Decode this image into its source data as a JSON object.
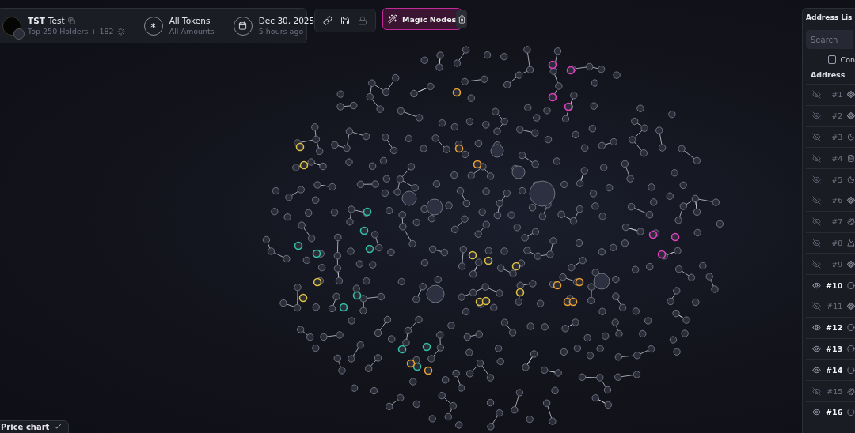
{
  "header": {
    "token": {
      "symbol": "TST",
      "name": "Test",
      "subtitle": "Top 250 Holders + 182"
    },
    "filter": {
      "title": "All Tokens",
      "subtitle": "All Amounts"
    },
    "date": {
      "title": "Dec 30, 2025",
      "subtitle": "5 hours ago"
    }
  },
  "toolbar": {
    "magic_button": "Magic Nodes"
  },
  "address_panel": {
    "title": "Address Lis",
    "search_placeholder": "Search",
    "checkbox": {
      "label": "Con",
      "checked": false
    },
    "column": "Address",
    "rows": [
      {
        "rank": "#1",
        "hidden": true,
        "kind": "bnb"
      },
      {
        "rank": "#2",
        "hidden": true,
        "kind": "bnb"
      },
      {
        "rank": "#3",
        "hidden": true,
        "kind": "moon"
      },
      {
        "rank": "#4",
        "hidden": true,
        "kind": "doc"
      },
      {
        "rank": "#5",
        "hidden": true,
        "kind": "moon"
      },
      {
        "rank": "#6",
        "hidden": true,
        "kind": "bnb"
      },
      {
        "rank": "#7",
        "hidden": true,
        "kind": "rabbit"
      },
      {
        "rank": "#8",
        "hidden": true,
        "kind": "mountain"
      },
      {
        "rank": "#9",
        "hidden": true,
        "kind": "bnb"
      },
      {
        "rank": "#10",
        "hidden": false,
        "kind": "circle"
      },
      {
        "rank": "#11",
        "hidden": true,
        "kind": "bnb"
      },
      {
        "rank": "#12",
        "hidden": false,
        "kind": "circle"
      },
      {
        "rank": "#13",
        "hidden": false,
        "kind": "circle"
      },
      {
        "rank": "#14",
        "hidden": false,
        "kind": "circle"
      },
      {
        "rank": "#15",
        "hidden": true,
        "kind": "rabbit"
      },
      {
        "rank": "#16",
        "hidden": false,
        "kind": "circle"
      }
    ]
  },
  "price_chart_button": "Price chart"
}
